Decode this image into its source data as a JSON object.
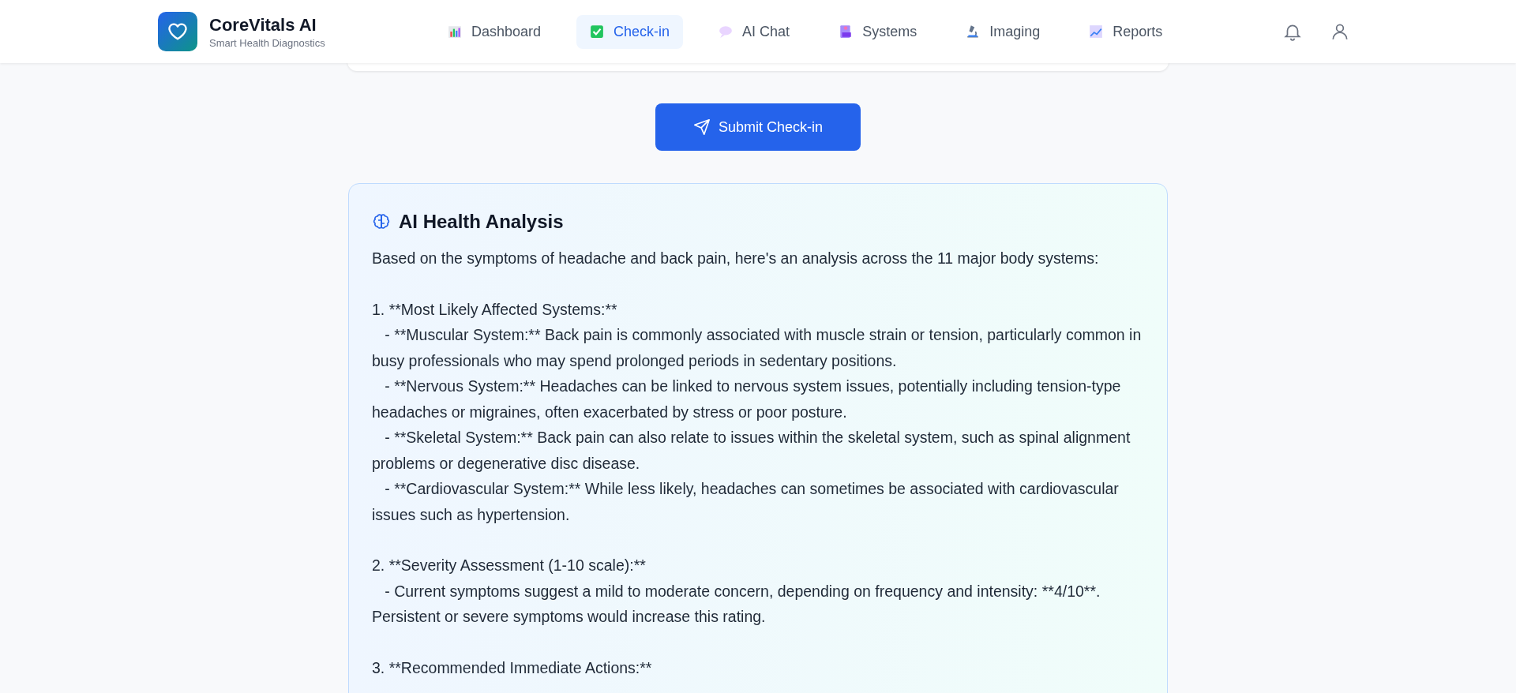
{
  "brand": {
    "name": "CoreVitals AI",
    "tagline": "Smart Health Diagnostics"
  },
  "nav": [
    {
      "label": "Dashboard",
      "selected": false
    },
    {
      "label": "Check-in",
      "selected": true
    },
    {
      "label": "AI Chat",
      "selected": false
    },
    {
      "label": "Systems",
      "selected": false
    },
    {
      "label": "Imaging",
      "selected": false
    },
    {
      "label": "Reports",
      "selected": false
    }
  ],
  "submit_button": "Submit Check-in",
  "analysis": {
    "title": "AI Health Analysis",
    "blocks": [
      [
        "Based on the symptoms of headache and back pain, here's an analysis across the 11 major body systems:"
      ],
      [
        "1. **Most Likely Affected Systems:**",
        "   - **Muscular System:** Back pain is commonly associated with muscle strain or tension, particularly common in busy professionals who may spend prolonged periods in sedentary positions.",
        "   - **Nervous System:** Headaches can be linked to nervous system issues, potentially including tension-type headaches or migraines, often exacerbated by stress or poor posture.",
        "   - **Skeletal System:** Back pain can also relate to issues within the skeletal system, such as spinal alignment problems or degenerative disc disease.",
        "   - **Cardiovascular System:** While less likely, headaches can sometimes be associated with cardiovascular issues such as hypertension."
      ],
      [
        "2. **Severity Assessment (1-10 scale):**",
        "   - Current symptoms suggest a mild to moderate concern, depending on frequency and intensity: **4/10**. Persistent or severe symptoms would increase this rating."
      ],
      [
        "3. **Recommended Immediate Actions:**"
      ]
    ]
  }
}
